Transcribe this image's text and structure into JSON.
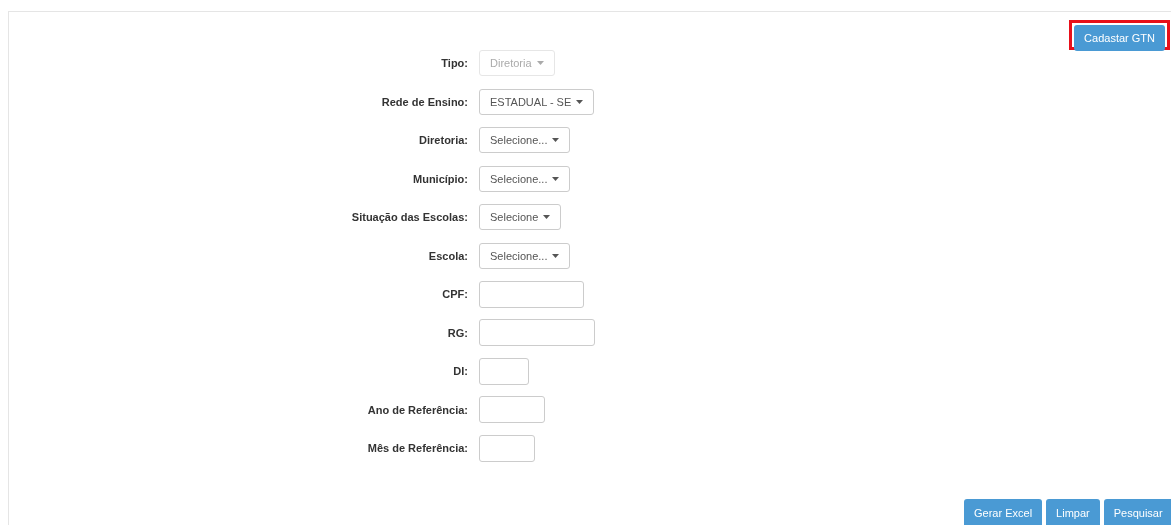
{
  "top_button": {
    "label": "Cadastar GTN",
    "highlighted": true
  },
  "fields": [
    {
      "label": "Tipo:",
      "kind": "dropdown",
      "value": "Diretoria",
      "disabled": true
    },
    {
      "label": "Rede de Ensino:",
      "kind": "dropdown",
      "value": "ESTADUAL - SE",
      "disabled": false
    },
    {
      "label": "Diretoria:",
      "kind": "dropdown",
      "value": "Selecione...",
      "disabled": false
    },
    {
      "label": "Município:",
      "kind": "dropdown",
      "value": "Selecione...",
      "disabled": false
    },
    {
      "label": "Situação das Escolas:",
      "kind": "dropdown",
      "value": "Selecione",
      "disabled": false
    },
    {
      "label": "Escola:",
      "kind": "dropdown",
      "value": "Selecione...",
      "disabled": false
    },
    {
      "label": "CPF:",
      "kind": "text"
    },
    {
      "label": "RG:",
      "kind": "text"
    },
    {
      "label": "DI:",
      "kind": "text"
    },
    {
      "label": "Ano de Referência:",
      "kind": "text"
    },
    {
      "label": "Mês de Referência:",
      "kind": "text"
    }
  ],
  "actions": [
    "Gerar Excel",
    "Limpar",
    "Pesquisar"
  ]
}
